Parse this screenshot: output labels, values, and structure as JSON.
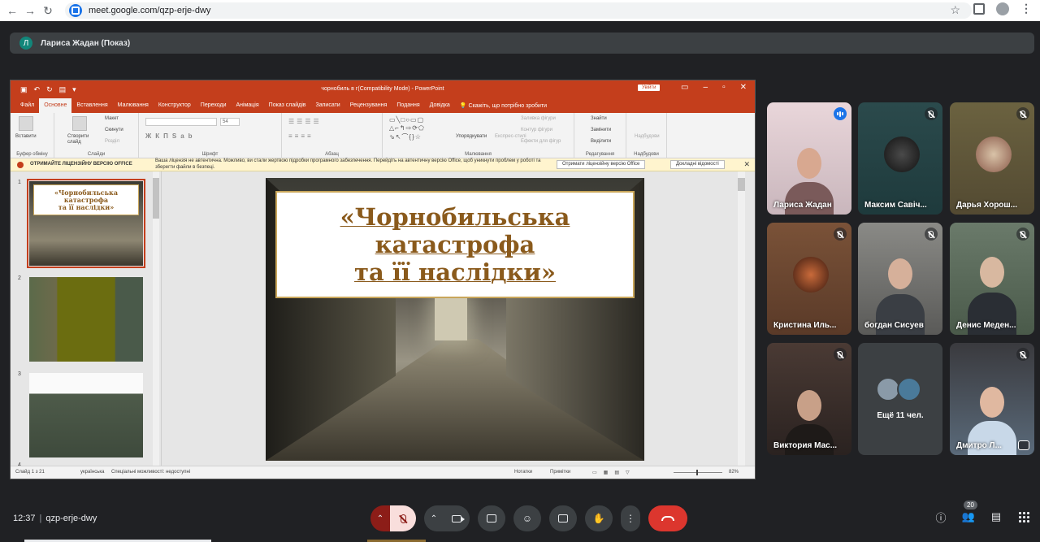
{
  "browser": {
    "url": "meet.google.com/qzp-erje-dwy"
  },
  "presenter": {
    "initial": "Л",
    "banner": "Лариса Жадан (Показ)"
  },
  "powerpoint": {
    "doc_title": "чорнобиль в г(Compatibility Mode)  -  PowerPoint",
    "signin": "Увійти",
    "tabs": [
      "Файл",
      "Основне",
      "Вставлення",
      "Малювання",
      "Конструктор",
      "Переходи",
      "Анімація",
      "Показ слайдів",
      "Записати",
      "Рецензування",
      "Подання",
      "Довідка"
    ],
    "tell_me": "Скажіть, що потрібно зробити",
    "groups": {
      "clipboard": "Буфер обміну",
      "slides": "Слайди",
      "font": "Шрифт",
      "paragraph": "Абзац",
      "drawing": "Малювання",
      "editing": "Редагування",
      "addins": "Надбудови"
    },
    "ribbon_labels": {
      "paste": "Вставити",
      "new_slide": "Створити слайд",
      "layout": "Макет",
      "reset": "Скинути",
      "section": "Розділ",
      "arrange": "Упорядкувати",
      "quick_styles": "Експрес-стилі",
      "shape_fill": "Заливка фігури",
      "shape_outline": "Контур фігури",
      "shape_effects": "Ефекти для фігур",
      "find": "Знайти",
      "replace": "Замінити",
      "select": "Виділити",
      "addins_btn": "Надбудови",
      "font_size": "54"
    },
    "license": {
      "title": "ОТРИМАЙТЕ ЛІЦЕНЗІЙНУ ВЕРСІЮ OFFICE",
      "message": "Ваша ліцензія не автентична. Можливо, ви стали жертвою підробки програмного забезпечення. Перейдіть на автентичну версію Office, щоб уникнути проблем у роботі та зберегти файли в безпеці.",
      "btn_get": "Отримати ліцензійну версію Office",
      "btn_more": "Докладні відомості"
    },
    "thumbnails": [
      {
        "num": "1"
      },
      {
        "num": "2"
      },
      {
        "num": "3"
      },
      {
        "num": "4"
      }
    ],
    "slide_title": [
      "«Чорнобильська",
      "катастрофа",
      "та її наслідки»"
    ],
    "thumb1_title": [
      "«Чорнобильська",
      "катастрофа",
      "та її наслідки»"
    ],
    "status": {
      "slide": "Слайд 1 з 21",
      "language": "українська",
      "accessibility": "Спеціальні можливості: недоступні",
      "notes": "Нотатки",
      "comments": "Примітки",
      "zoom": "82%"
    }
  },
  "participants": [
    {
      "name": "Лариса Жадан",
      "speaking": true
    },
    {
      "name": "Максим Савіч...",
      "muted": true
    },
    {
      "name": "Дарья Хорош...",
      "muted": true
    },
    {
      "name": "Кристина Иль...",
      "muted": true
    },
    {
      "name": "богдан Сисуев",
      "muted": true
    },
    {
      "name": "Денис Меден...",
      "muted": true
    },
    {
      "name": "Виктория Мас...",
      "muted": true
    },
    {
      "name": "Ещё 11 чел."
    },
    {
      "name": "Дмитро Л...",
      "muted": true
    }
  ],
  "meeting": {
    "time": "12:37",
    "code": "qzp-erje-dwy",
    "people_count": "20"
  },
  "colors": {
    "ppt_accent": "#c43e1c",
    "end_call": "#dc362e",
    "meet_bg": "#202124"
  }
}
